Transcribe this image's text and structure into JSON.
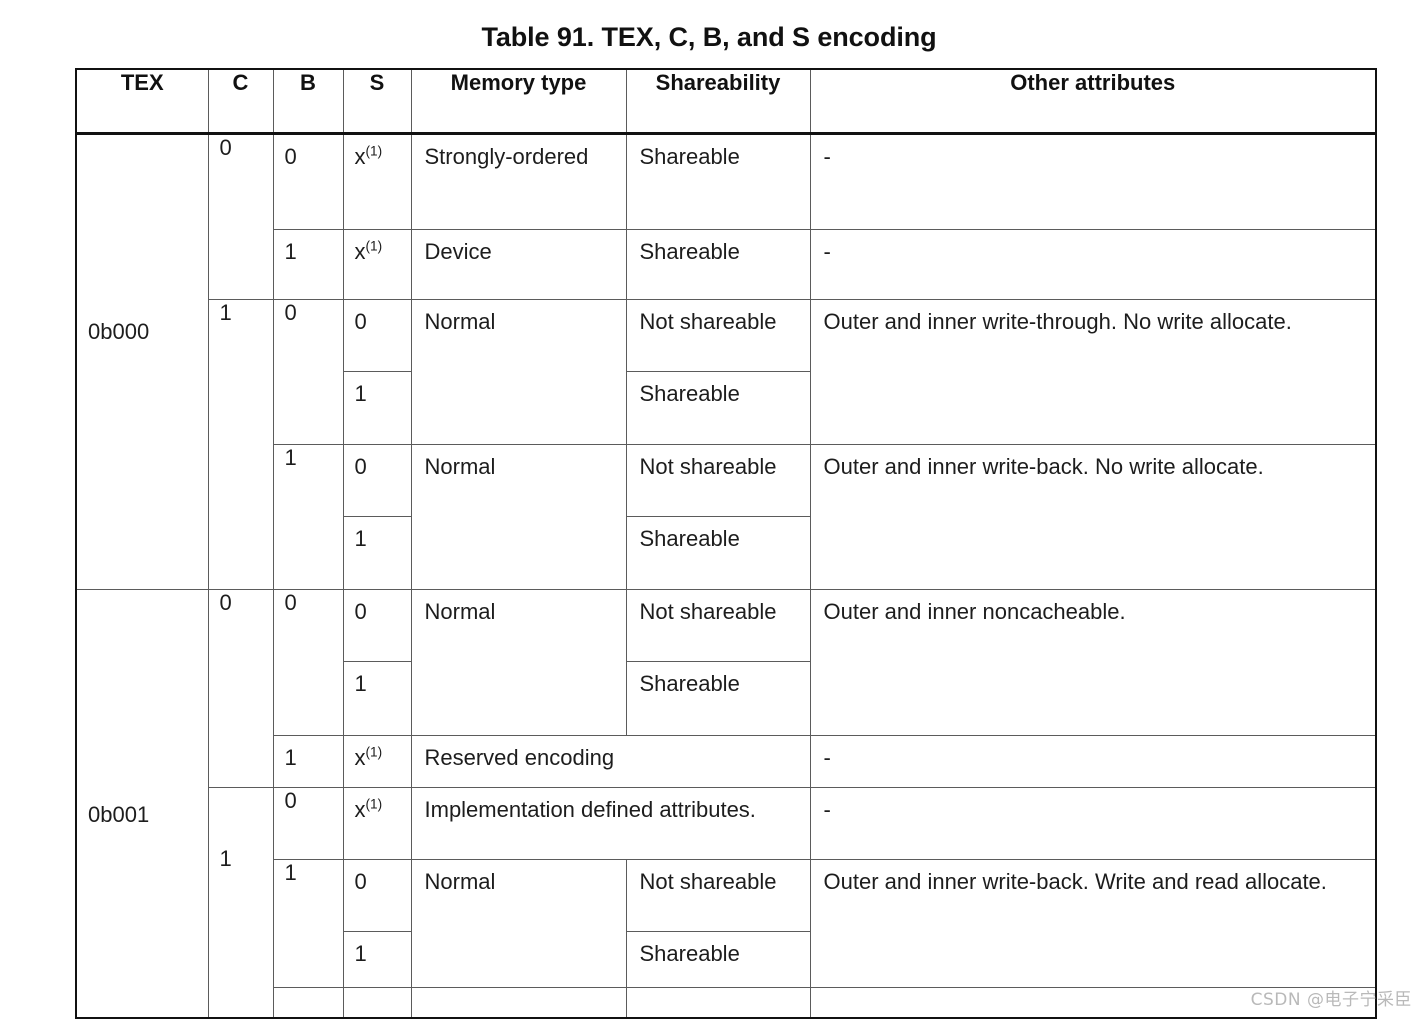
{
  "caption": "Table 91. TEX, C, B, and S encoding",
  "columns": [
    {
      "key": "tex",
      "label": "TEX"
    },
    {
      "key": "c",
      "label": "C"
    },
    {
      "key": "b",
      "label": "B"
    },
    {
      "key": "s",
      "label": "S"
    },
    {
      "key": "memory_type",
      "label": "Memory type"
    },
    {
      "key": "shareability",
      "label": "Shareability"
    },
    {
      "key": "other_attributes",
      "label": "Other attributes"
    }
  ],
  "footnote_marker": "(1)",
  "dash": "-",
  "x_value": "x",
  "rows": {
    "tex_000": "0b000",
    "tex_001": "0b001",
    "c0": "0",
    "c1": "1",
    "b0": "0",
    "b1": "1",
    "s0": "0",
    "s1": "1",
    "mt_strongly_ordered": "Strongly-ordered",
    "mt_device": "Device",
    "mt_normal": "Normal",
    "mt_reserved": "Reserved encoding",
    "mt_impl_defined": "Implementation defined attributes.",
    "sh_shareable": "Shareable",
    "sh_not_shareable": "Not shareable",
    "oa_write_through": "Outer and inner write-through. No write allocate.",
    "oa_write_back_no_alloc": "Outer and inner write-back. No write allocate.",
    "oa_noncacheable": "Outer and inner noncacheable.",
    "oa_write_back_alloc": "Outer and inner write-back. Write and read allocate."
  },
  "watermark": "CSDN @电子宁采臣"
}
